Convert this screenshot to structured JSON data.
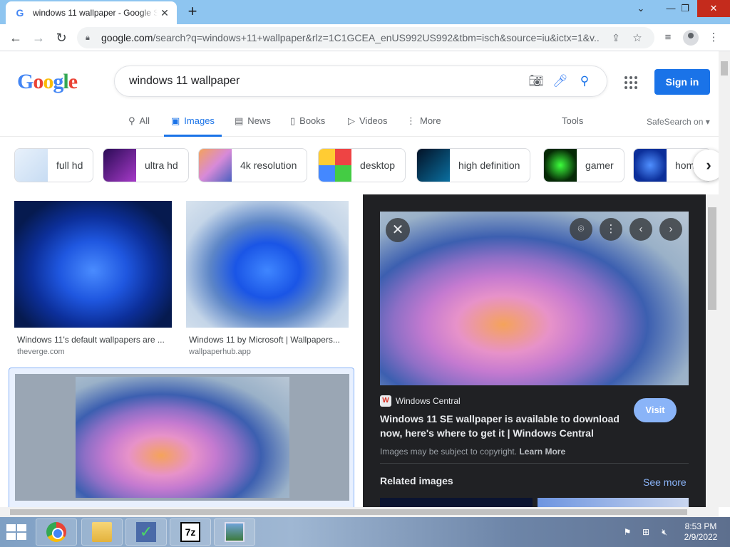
{
  "browser": {
    "tab_title": "windows 11 wallpaper - Google Search",
    "favicon": "G",
    "url_host": "google.com",
    "url_rest": "/search?q=windows+11+wallpaper&rlz=1C1GCEA_enUS992US992&tbm=isch&source=iu&ictx=1&v..."
  },
  "google": {
    "query": "windows 11 wallpaper",
    "sign_in": "Sign in",
    "tabs": [
      {
        "label": "All",
        "icon": "search-icon"
      },
      {
        "label": "Images",
        "icon": "image-icon"
      },
      {
        "label": "News",
        "icon": "news-icon"
      },
      {
        "label": "Books",
        "icon": "book-icon"
      },
      {
        "label": "Videos",
        "icon": "video-icon"
      },
      {
        "label": "More",
        "icon": "more-vert-icon"
      }
    ],
    "tools": "Tools",
    "safesearch": "SafeSearch on"
  },
  "chips": [
    {
      "label": "full hd"
    },
    {
      "label": "ultra hd"
    },
    {
      "label": "4k resolution"
    },
    {
      "label": "desktop"
    },
    {
      "label": "high definition"
    },
    {
      "label": "gamer"
    },
    {
      "label": "hom"
    }
  ],
  "results": [
    {
      "caption": "Windows 11's default wallpapers are ...",
      "source": "theverge.com"
    },
    {
      "caption": "Windows 11 by Microsoft | Wallpapers...",
      "source": "wallpaperhub.app"
    }
  ],
  "panel": {
    "source_name": "Windows Central",
    "title": "Windows 11 SE wallpaper is available to download now, here's where to get it | Windows Central",
    "visit": "Visit",
    "copyright": "Images may be subject to copyright.",
    "learn_more": "Learn More",
    "related": "Related images",
    "see_more": "See more"
  },
  "taskbar": {
    "time": "8:53 PM",
    "date": "2/9/2022"
  }
}
